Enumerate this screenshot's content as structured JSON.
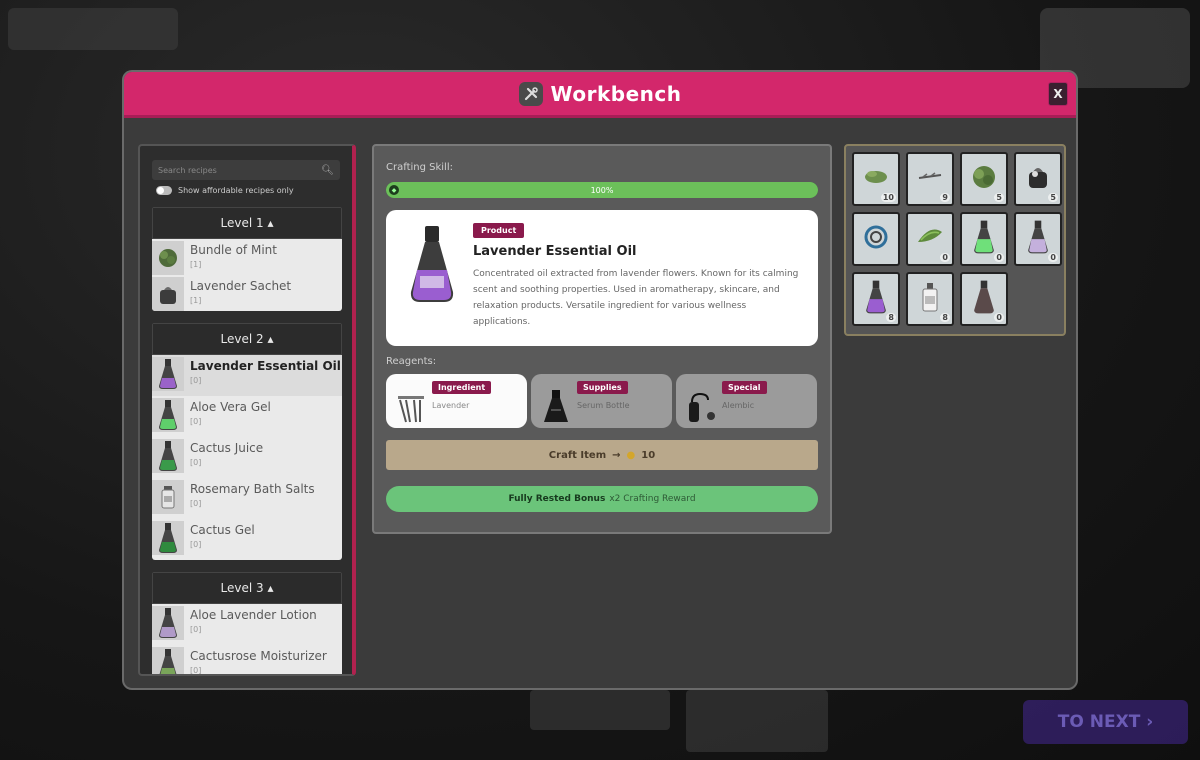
{
  "background": {
    "next_button_label": "TO NEXT ›"
  },
  "modal": {
    "title": "Workbench",
    "close_label": "X"
  },
  "recipes": {
    "search_placeholder": "Search recipes",
    "filter_label": "Show affordable recipes only",
    "levels": [
      {
        "label": "Level 1 ▴",
        "items": [
          {
            "name": "Bundle of Mint",
            "count": "[1]",
            "icon": "mint-icon"
          },
          {
            "name": "Lavender Sachet",
            "count": "[1]",
            "icon": "sachet-icon"
          }
        ]
      },
      {
        "label": "Level 2 ▴",
        "items": [
          {
            "name": "Lavender Essential Oil",
            "count": "[0]",
            "icon": "purple-flask-icon",
            "active": true
          },
          {
            "name": "Aloe Vera Gel",
            "count": "[0]",
            "icon": "green-flask-icon"
          },
          {
            "name": "Cactus Juice",
            "count": "[0]",
            "icon": "green-flask-icon"
          },
          {
            "name": "Rosemary Bath Salts",
            "count": "[0]",
            "icon": "salts-jar-icon"
          },
          {
            "name": "Cactus Gel",
            "count": "[0]",
            "icon": "green-flask-icon"
          }
        ]
      },
      {
        "label": "Level 3 ▴",
        "items": [
          {
            "name": "Aloe Lavender Lotion",
            "count": "[0]",
            "icon": "purple-flask-icon"
          },
          {
            "name": "Cactusrose Moisturizer",
            "count": "[0]",
            "icon": "green-flask-icon"
          }
        ]
      }
    ]
  },
  "crafting": {
    "skill_label": "Crafting Skill:",
    "skill_percent_text": "100%",
    "skill_fraction": 1.0,
    "product": {
      "tag": "Product",
      "name": "Lavender Essential Oil",
      "description": "Concentrated oil extracted from lavender flowers. Known for its calming scent and soothing properties. Used in aromatherapy, skincare, and relaxation products. Versatile ingredient for various wellness applications."
    },
    "reagents_label": "Reagents:",
    "reagents": [
      {
        "tag": "Ingredient",
        "name": "Lavender",
        "icon": "lavender-icon"
      },
      {
        "tag": "Supplies",
        "name": "Serum Bottle",
        "icon": "serum-bottle-icon"
      },
      {
        "tag": "Special",
        "name": "Alembic",
        "icon": "alembic-icon"
      }
    ],
    "craft_label": "Craft Item",
    "craft_cost": "10",
    "bonus_label": "Fully Rested Bonus",
    "bonus_reward": "x2 Crafting Reward"
  },
  "inventory": [
    {
      "icon": "mint-icon",
      "count": "10"
    },
    {
      "icon": "twig-icon",
      "count": "9"
    },
    {
      "icon": "herb-bundle-icon",
      "count": "5"
    },
    {
      "icon": "sachet-icon",
      "count": "5"
    },
    {
      "icon": "rope-coil-icon",
      "count": ""
    },
    {
      "icon": "aloe-leaf-icon",
      "count": "0"
    },
    {
      "icon": "green-flask-icon",
      "count": "0"
    },
    {
      "icon": "purple-flask-icon",
      "count": "0"
    },
    {
      "icon": "purple-flask-icon",
      "count": "8"
    },
    {
      "icon": "serum-bottle-icon",
      "count": "8"
    },
    {
      "icon": "empty-flask-icon",
      "count": "0"
    }
  ],
  "colors": {
    "header": "#d3276b",
    "tag": "#8a1a4c",
    "skill_bar": "#6cc05a",
    "craft_button": "#b9a88b",
    "bonus_bar": "#6bc47a"
  }
}
